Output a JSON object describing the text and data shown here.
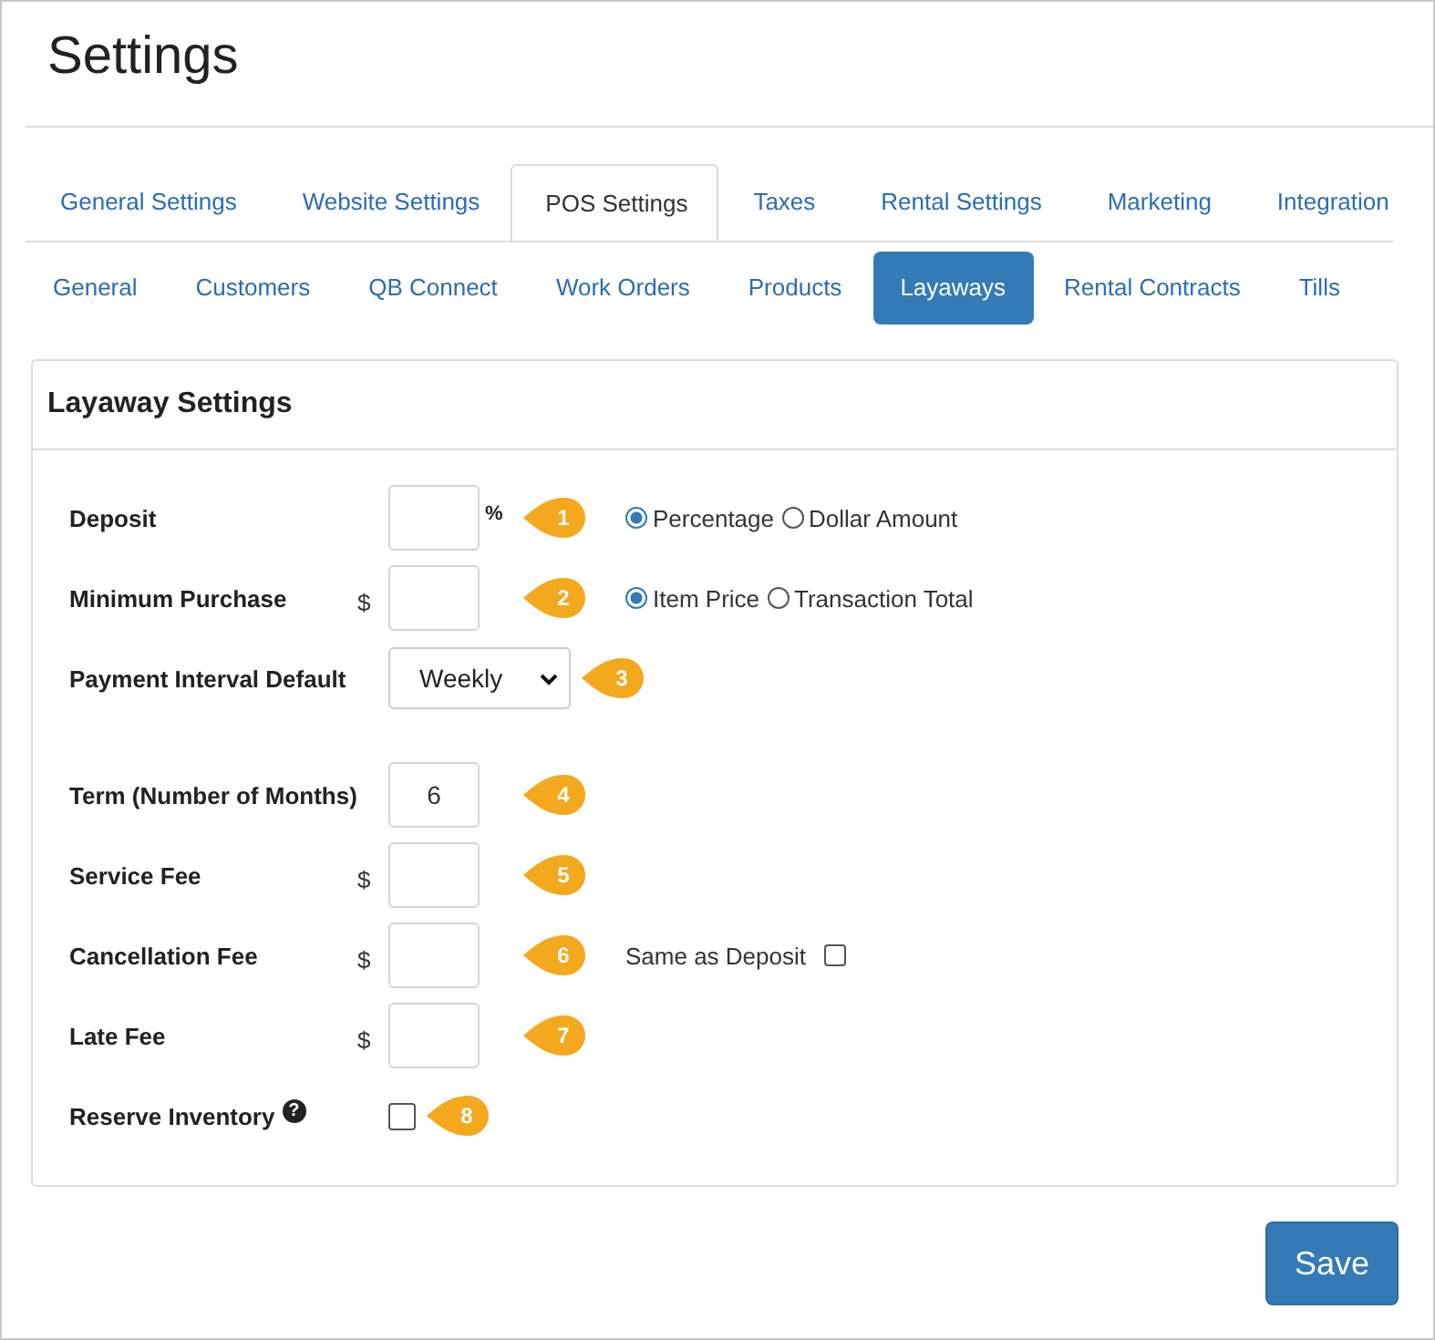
{
  "page_title": "Settings",
  "tabs": [
    {
      "label": "General Settings",
      "selected": false
    },
    {
      "label": "Website Settings",
      "selected": false
    },
    {
      "label": "POS Settings",
      "selected": true
    },
    {
      "label": "Taxes",
      "selected": false
    },
    {
      "label": "Rental Settings",
      "selected": false
    },
    {
      "label": "Marketing",
      "selected": false
    },
    {
      "label": "Integration",
      "selected": false
    }
  ],
  "subtabs": [
    {
      "label": "General",
      "selected": false
    },
    {
      "label": "Customers",
      "selected": false
    },
    {
      "label": "QB Connect",
      "selected": false
    },
    {
      "label": "Work Orders",
      "selected": false
    },
    {
      "label": "Products",
      "selected": false
    },
    {
      "label": "Layaways",
      "selected": true
    },
    {
      "label": "Rental Contracts",
      "selected": false
    },
    {
      "label": "Tills",
      "selected": false
    }
  ],
  "panel": {
    "title": "Layaway Settings",
    "groups": [
      [
        {
          "kind": "input",
          "label": "Deposit",
          "suffix": "%",
          "marker": "1",
          "options": [
            {
              "label": "Percentage",
              "selected": true
            },
            {
              "label": "Dollar Amount",
              "selected": false
            }
          ]
        },
        {
          "kind": "input",
          "label": "Minimum Purchase",
          "prefix": "$",
          "marker": "2",
          "options": [
            {
              "label": "Item Price",
              "selected": true
            },
            {
              "label": "Transaction Total",
              "selected": false
            }
          ]
        },
        {
          "kind": "select",
          "label": "Payment Interval Default",
          "value": "Weekly",
          "marker": "3"
        }
      ],
      [
        {
          "kind": "input",
          "label": "Term (Number of Months)",
          "value": "6",
          "marker": "4"
        },
        {
          "kind": "input",
          "label": "Service Fee",
          "prefix": "$",
          "marker": "5"
        },
        {
          "kind": "input",
          "label": "Cancellation Fee",
          "prefix": "$",
          "marker": "6",
          "extra": {
            "label": "Same as Deposit",
            "checked": false
          }
        },
        {
          "kind": "input",
          "label": "Late Fee",
          "prefix": "$",
          "marker": "7"
        },
        {
          "kind": "checkbox",
          "label": "Reserve Inventory",
          "help": "?",
          "checked": false,
          "marker": "8"
        }
      ]
    ]
  },
  "save_button": "Save"
}
